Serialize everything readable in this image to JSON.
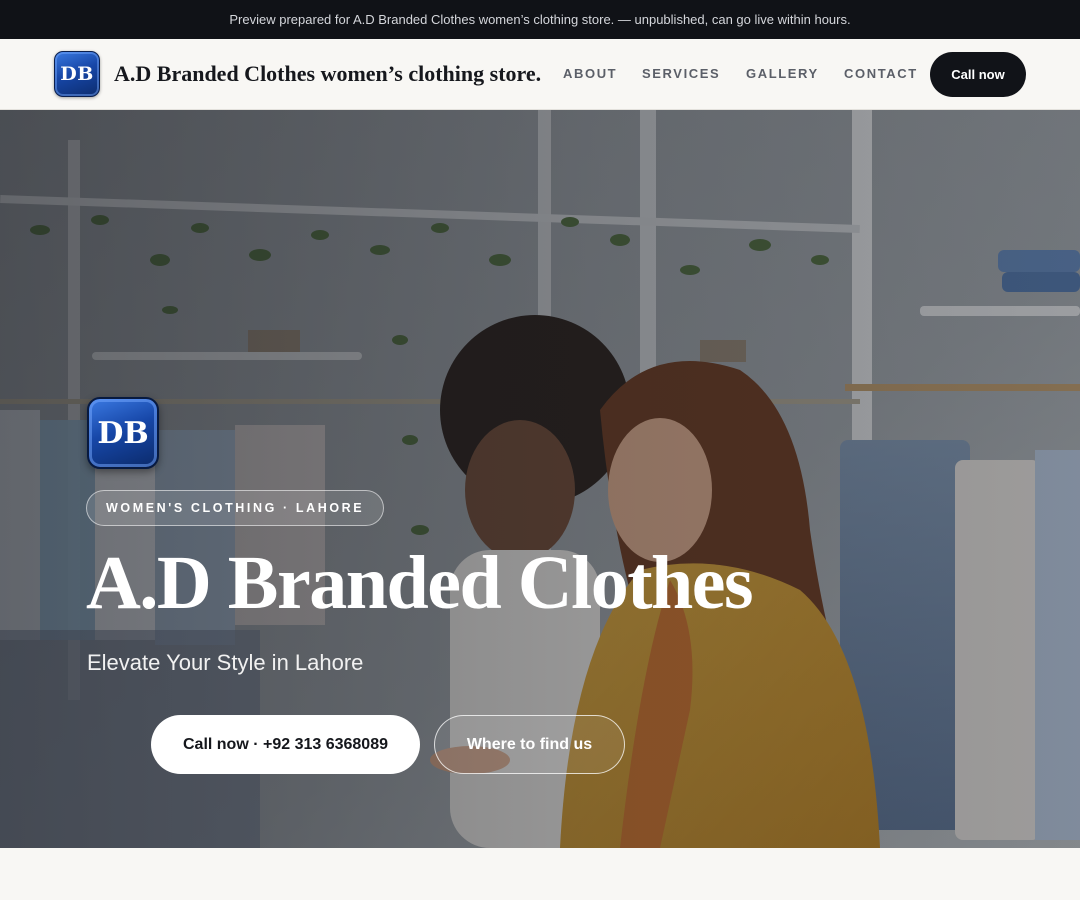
{
  "preview_banner": "Preview prepared for A.D Branded Clothes women’s clothing store. — unpublished, can go live within hours.",
  "header": {
    "logo_text": "DB",
    "brand_name": "A.D Branded Clothes women’s clothing store.",
    "nav": [
      "ABOUT",
      "SERVICES",
      "GALLERY",
      "CONTACT"
    ],
    "cta_label": "Call now"
  },
  "hero": {
    "logo_text": "DB",
    "eyebrow": "WOMEN'S CLOTHING · LAHORE",
    "title": "A.D Branded Clothes",
    "subtitle": "Elevate Your Style in Lahore",
    "primary_button": "Call now · +92 313 6368089",
    "secondary_button": "Where to find us",
    "image_description": "two-women-browsing-clothing-rack"
  },
  "colors": {
    "dark": "#111318",
    "page_bg": "#f8f7f4",
    "logo_blue": "#1747a8",
    "jacket_yellow": "#e2ac3a"
  }
}
